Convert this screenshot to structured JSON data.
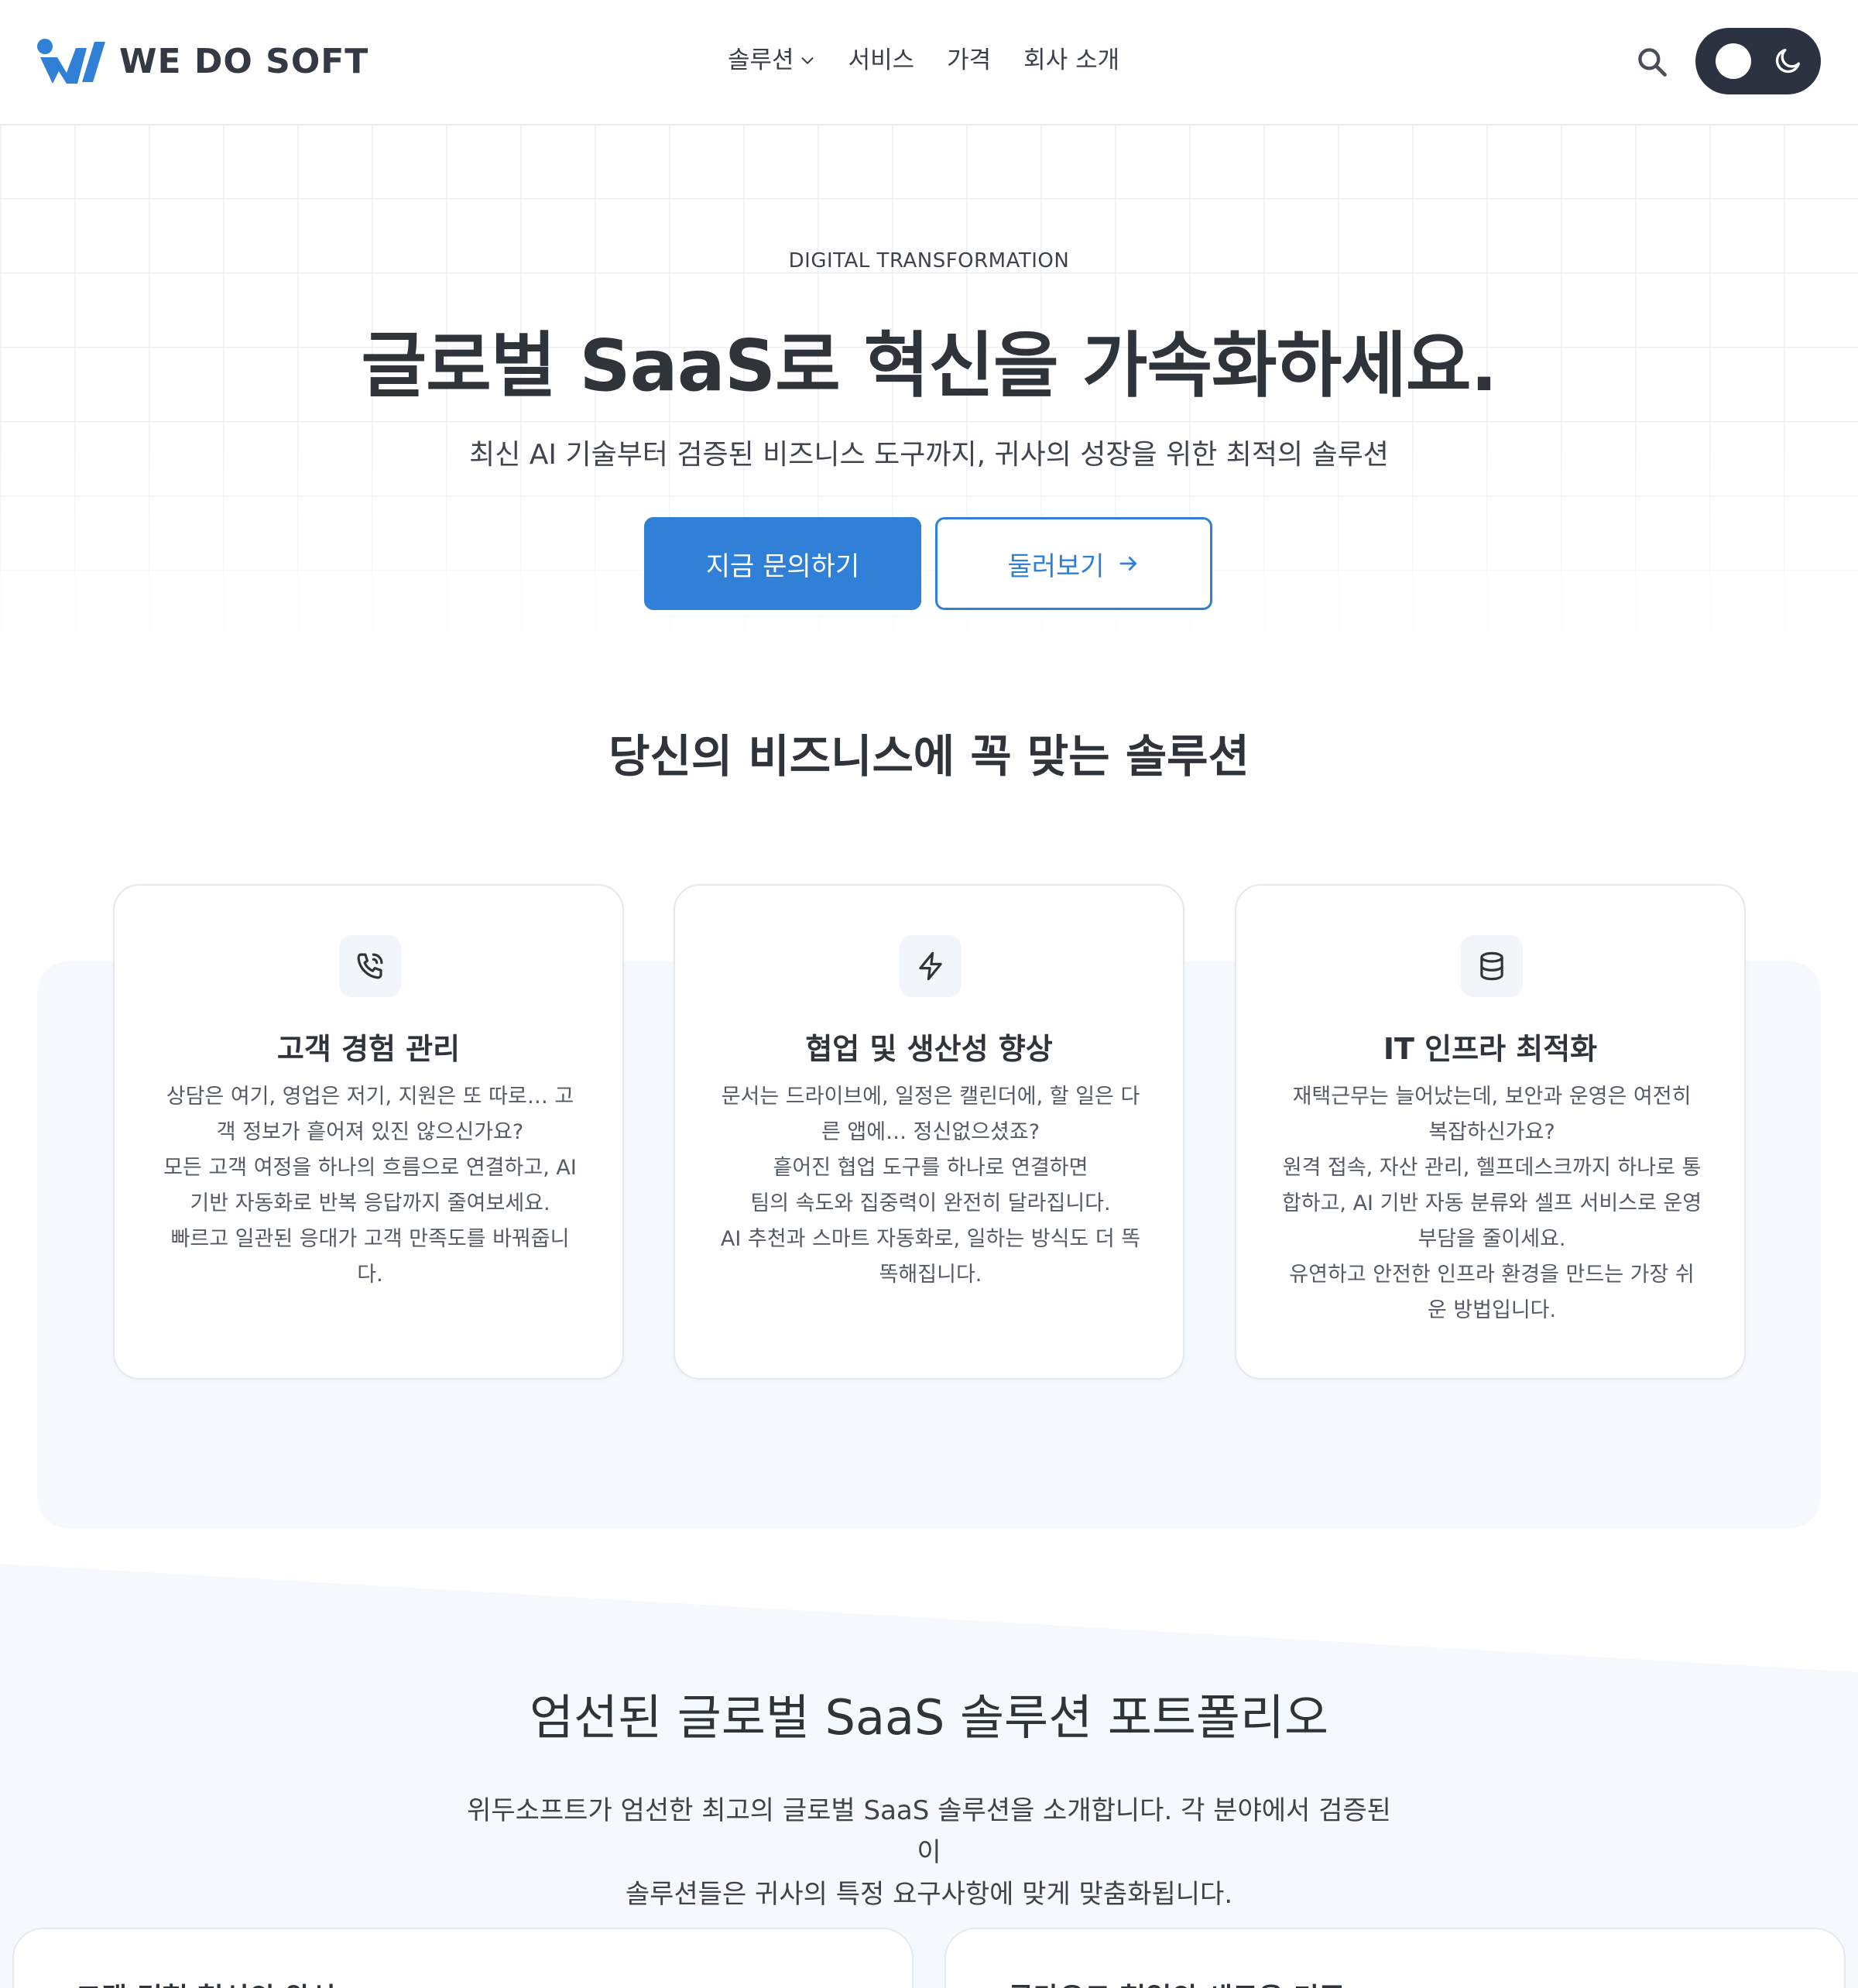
{
  "header": {
    "logo_text": "WE DO SOFT",
    "nav": [
      {
        "label": "솔루션",
        "has_dropdown": true
      },
      {
        "label": "서비스"
      },
      {
        "label": "가격"
      },
      {
        "label": "회사 소개"
      }
    ],
    "search_icon": "search-icon",
    "theme_toggle_icon": "moon-icon"
  },
  "hero": {
    "eyebrow": "DIGITAL TRANSFORMATION",
    "title": "글로벌 SaaS로 혁신을 가속화하세요.",
    "subtitle": "최신 AI 기술부터 검증된 비즈니스 도구까지, 귀사의 성장을 위한 최적의 솔루션",
    "primary_button": "지금 문의하기",
    "secondary_button": "둘러보기"
  },
  "solutions": {
    "title": "당신의 비즈니스에 꼭 맞는 솔루션",
    "cards": [
      {
        "icon": "phone-icon",
        "title": "고객 경험 관리",
        "lines": [
          "상담은 여기, 영업은 저기, 지원은 또 따로… 고객 정보가 흩어져 있진 않으신가요?",
          "모든 고객 여정을 하나의 흐름으로 연결하고, AI 기반 자동화로 반복 응답까지 줄여보세요.",
          "빠르고 일관된 응대가 고객 만족도를 바꿔줍니다."
        ]
      },
      {
        "icon": "lightning-icon",
        "title": "협업 및 생산성 향상",
        "lines": [
          "문서는 드라이브에, 일정은 캘린더에, 할 일은 다른 앱에… 정신없으셨죠?",
          "흩어진 협업 도구를 하나로 연결하면",
          "팀의 속도와 집중력이 완전히 달라집니다.",
          "AI 추천과 스마트 자동화로, 일하는 방식도 더 똑똑해집니다."
        ]
      },
      {
        "icon": "database-icon",
        "title": "IT 인프라 최적화",
        "lines": [
          "재택근무는 늘어났는데, 보안과 운영은 여전히 복잡하신가요?",
          "원격 접속, 자산 관리, 헬프데스크까지 하나로 통합하고, AI 기반 자동 분류와 셀프 서비스로 운영 부담을 줄이세요.",
          "유연하고 안전한 인프라 환경을 만드는 가장 쉬운 방법입니다."
        ]
      }
    ]
  },
  "portfolio": {
    "title": "엄선된 글로벌 SaaS 솔루션 포트폴리오",
    "subtitle_line1": "위두소프트가 엄선한 최고의 글로벌 SaaS 솔루션을 소개합니다. 각 분야에서 검증된 이",
    "subtitle_line2": "솔루션들은 귀사의 특정 요구사항에 맞게 맞춤화됩니다.",
    "cards": [
      {
        "title": "고객 경험 혁신의 완성"
      },
      {
        "title": "클라우드 협업의 새로운 기준"
      }
    ]
  },
  "colors": {
    "accent": "#2f80d6",
    "dark": "#2b3240",
    "section_bg": "#f5f8fc"
  }
}
